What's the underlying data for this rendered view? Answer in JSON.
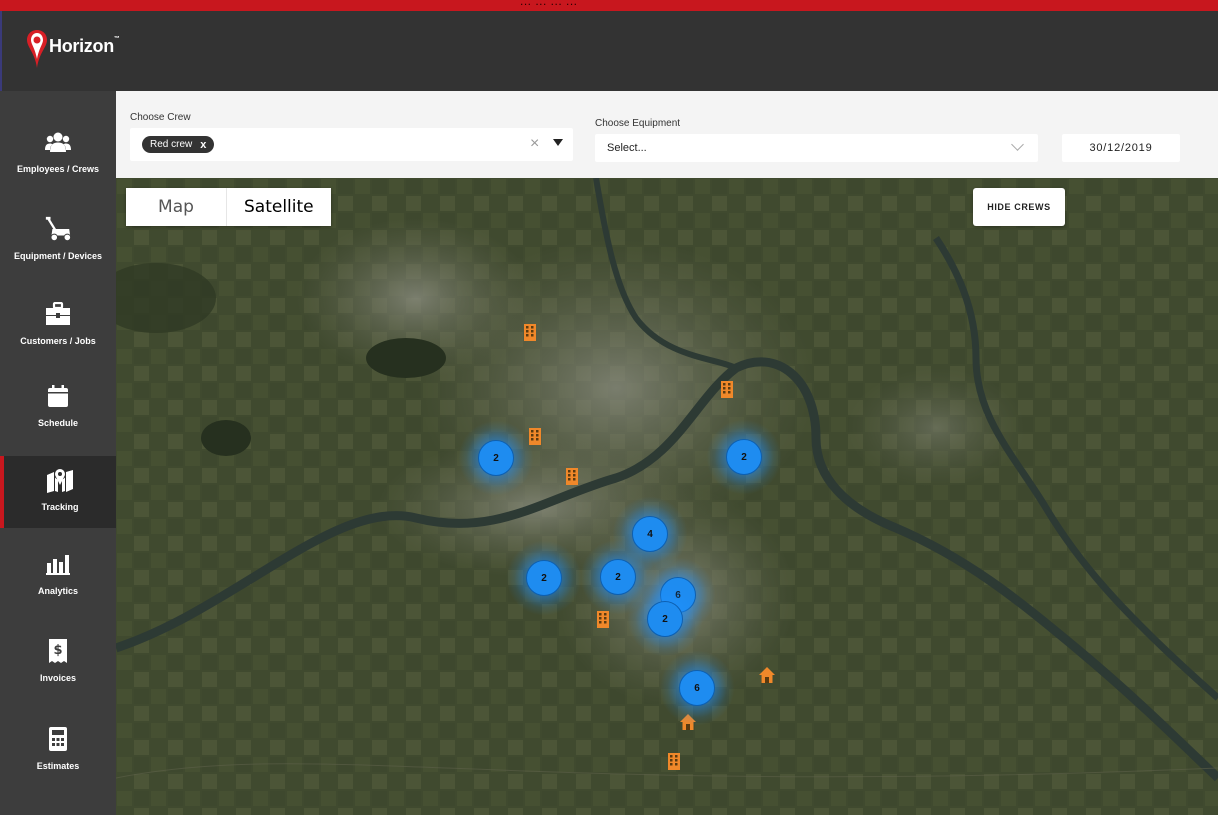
{
  "app": {
    "title": "Horizon",
    "trademark": "™",
    "banner_text": "... ... ... ...",
    "accent_color": "#c8171e"
  },
  "sidebar": {
    "items": [
      {
        "label": "Employees / Crews",
        "icon": "users-icon",
        "active": false
      },
      {
        "label": "Equipment / Devices",
        "icon": "lawnmower-icon",
        "active": false
      },
      {
        "label": "Customers / Jobs",
        "icon": "briefcase-icon",
        "active": false
      },
      {
        "label": "Schedule",
        "icon": "calendar-icon",
        "active": false
      },
      {
        "label": "Tracking",
        "icon": "map-pin-icon",
        "active": true
      },
      {
        "label": "Analytics",
        "icon": "bar-chart-icon",
        "active": false
      },
      {
        "label": "Invoices",
        "icon": "invoice-icon",
        "active": false
      },
      {
        "label": "Estimates",
        "icon": "calculator-icon",
        "active": false
      }
    ]
  },
  "filters": {
    "crew_label": "Choose Crew",
    "crew_selected": [
      "Red crew"
    ],
    "chip_remove": "x",
    "crew_clear": "×",
    "equipment_label": "Choose Equipment",
    "equipment_placeholder": "Select...",
    "date": "30/12/2019"
  },
  "map": {
    "type_map_label": "Map",
    "type_satellite_label": "Satellite",
    "selected_type": "Satellite",
    "hide_crews_label": "HIDE CREWS",
    "cluster_color": "#1e8cf0",
    "marker_color": "#f0882a",
    "clusters": [
      {
        "count": "2"
      },
      {
        "count": "2"
      },
      {
        "count": "4"
      },
      {
        "count": "2"
      },
      {
        "count": "2"
      },
      {
        "count": "6"
      },
      {
        "count": "2"
      },
      {
        "count": "6"
      }
    ],
    "markers": [
      {
        "kind": "building-icon"
      },
      {
        "kind": "building-icon"
      },
      {
        "kind": "building-icon"
      },
      {
        "kind": "building-icon"
      },
      {
        "kind": "building-icon"
      },
      {
        "kind": "building-icon"
      },
      {
        "kind": "house-icon"
      },
      {
        "kind": "house-icon"
      }
    ]
  }
}
